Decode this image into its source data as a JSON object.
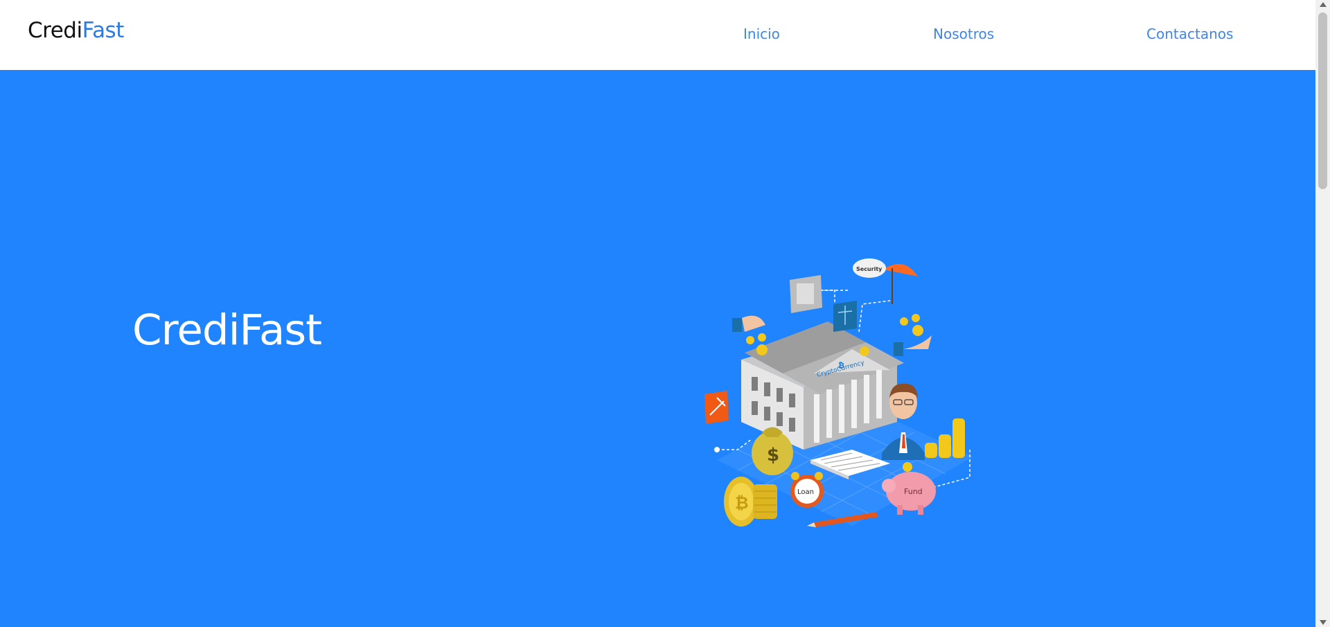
{
  "navbar": {
    "brand_part1": "Credi",
    "brand_part2": "Fast",
    "links": [
      "Inicio",
      "Nosotros",
      "Contactanos"
    ]
  },
  "hero": {
    "title": "CrediFast",
    "illustration": {
      "icon": "bank-cryptocurrency-illustration",
      "labels": {
        "security": "Security",
        "crypto": "CryptoCurrency",
        "loan": "Loan",
        "fund": "Fund"
      }
    }
  },
  "colors": {
    "accent": "#2c7be5",
    "hero_bg": "#1f84fd",
    "nav_link": "#3b86e8"
  }
}
